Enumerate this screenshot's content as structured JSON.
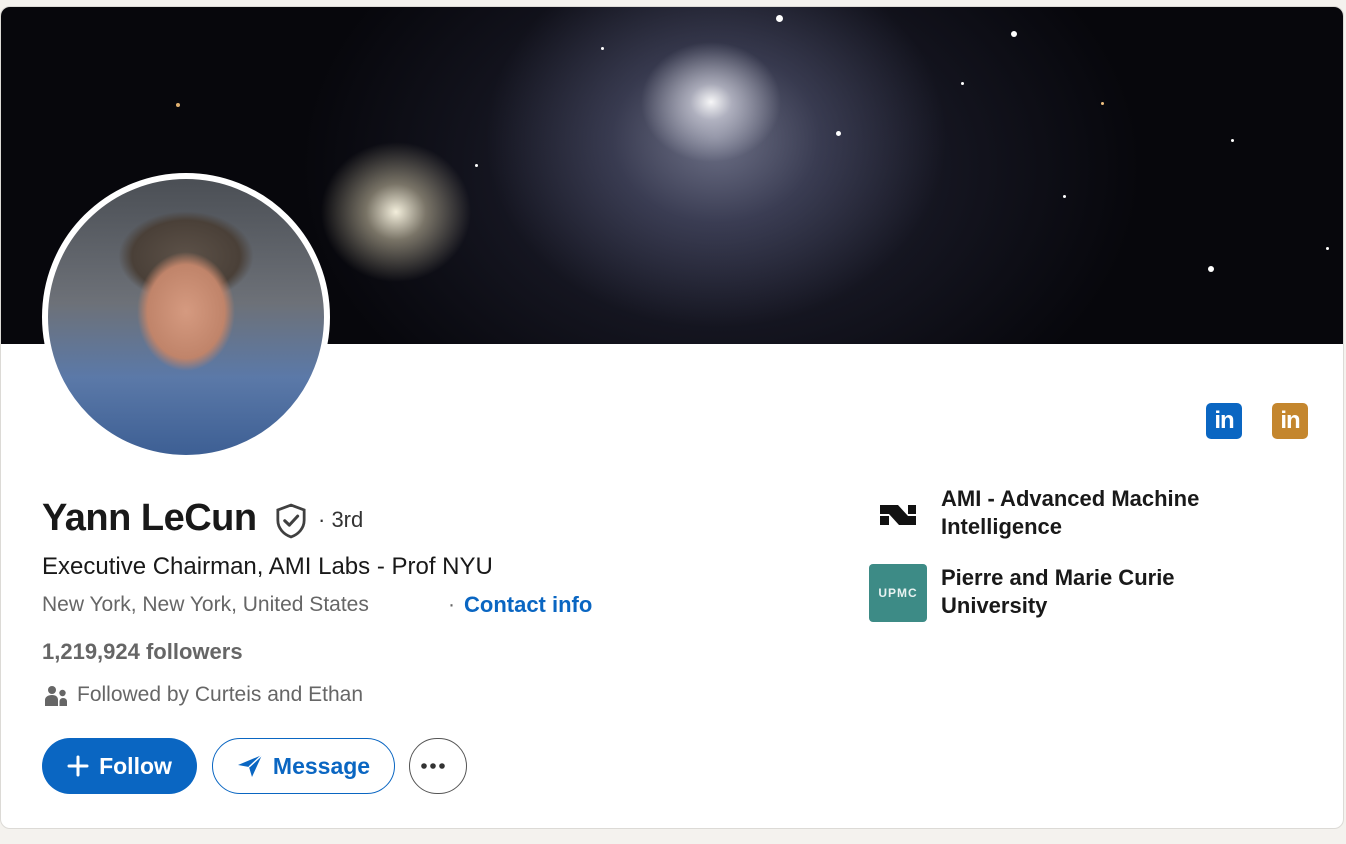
{
  "profile": {
    "name": "Yann LeCun",
    "connection_degree": "· 3rd",
    "headline": "Executive Chairman, AMI Labs - Prof NYU",
    "location": "New York, New York, United States",
    "separator": "·",
    "contact_info": "Contact info",
    "followers": "1,219,924 followers",
    "followed_by": "Followed by Curteis and Ethan"
  },
  "actions": {
    "follow": "Follow",
    "message": "Message",
    "more": "···"
  },
  "badges": {
    "linkedin_blue": "in",
    "linkedin_gold": "in",
    "blue_color": "#0a66c2",
    "gold_color": "#c4862e"
  },
  "organizations": [
    {
      "name": "AMI - Advanced Machine Intelligence",
      "logo_icon": "ami-logo-icon"
    },
    {
      "name": "Pierre and Marie Curie University",
      "logo_text": "UPMC",
      "logo_color": "#3d8b86"
    }
  ],
  "colors": {
    "accent": "#0a66c2",
    "muted_text": "#666666"
  }
}
